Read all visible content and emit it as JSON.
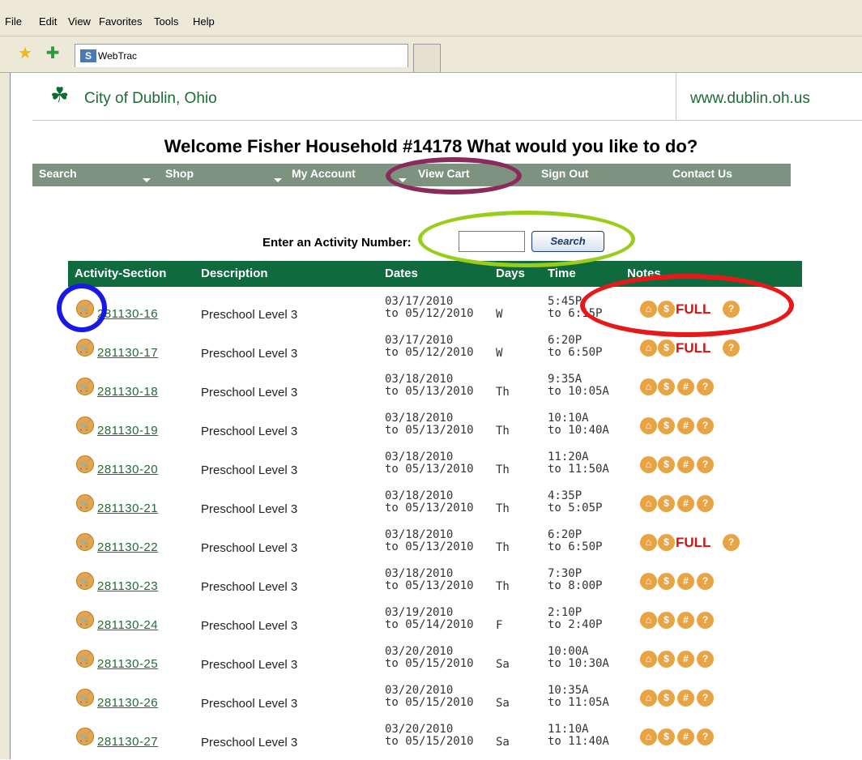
{
  "menu": [
    "File",
    "Edit",
    "View",
    "Favorites",
    "Tools",
    "Help"
  ],
  "tab": {
    "title": "WebTrac"
  },
  "site": {
    "city": "City of Dublin, Ohio",
    "url": "www.dublin.oh.us"
  },
  "welcome": "Welcome Fisher Household #14178  What would you like to do?",
  "nav": [
    "Search",
    "Shop",
    "My Account",
    "View Cart",
    "Sign Out",
    "Contact Us"
  ],
  "search": {
    "label": "Enter an Activity Number:",
    "button": "Search",
    "value": ""
  },
  "table": {
    "headers": [
      "Activity-Section",
      "Description",
      "Dates",
      "Days",
      "Time",
      "Notes"
    ],
    "rows": [
      {
        "code": "281130-16",
        "desc": "Preschool Level 3",
        "dates": "03/17/2010\nto 05/12/2010",
        "days": "W",
        "time": "5:45P\nto 6:15P",
        "full": true
      },
      {
        "code": "281130-17",
        "desc": "Preschool Level 3",
        "dates": "03/17/2010\nto 05/12/2010",
        "days": "W",
        "time": "6:20P\nto 6:50P",
        "full": true
      },
      {
        "code": "281130-18",
        "desc": "Preschool Level 3",
        "dates": "03/18/2010\nto 05/13/2010",
        "days": "Th",
        "time": "9:35A\nto 10:05A",
        "full": false
      },
      {
        "code": "281130-19",
        "desc": "Preschool Level 3",
        "dates": "03/18/2010\nto 05/13/2010",
        "days": "Th",
        "time": "10:10A\nto 10:40A",
        "full": false
      },
      {
        "code": "281130-20",
        "desc": "Preschool Level 3",
        "dates": "03/18/2010\nto 05/13/2010",
        "days": "Th",
        "time": "11:20A\nto 11:50A",
        "full": false
      },
      {
        "code": "281130-21",
        "desc": "Preschool Level 3",
        "dates": "03/18/2010\nto 05/13/2010",
        "days": "Th",
        "time": "4:35P\nto 5:05P",
        "full": false
      },
      {
        "code": "281130-22",
        "desc": "Preschool Level 3",
        "dates": "03/18/2010\nto 05/13/2010",
        "days": "Th",
        "time": "6:20P\nto 6:50P",
        "full": true
      },
      {
        "code": "281130-23",
        "desc": "Preschool Level 3",
        "dates": "03/18/2010\nto 05/13/2010",
        "days": "Th",
        "time": "7:30P\nto 8:00P",
        "full": false
      },
      {
        "code": "281130-24",
        "desc": "Preschool Level 3",
        "dates": "03/19/2010\nto 05/14/2010",
        "days": "F",
        "time": "2:10P\nto 2:40P",
        "full": false
      },
      {
        "code": "281130-25",
        "desc": "Preschool Level 3",
        "dates": "03/20/2010\nto 05/15/2010",
        "days": "Sa",
        "time": "10:00A\nto 10:30A",
        "full": false
      },
      {
        "code": "281130-26",
        "desc": "Preschool Level 3",
        "dates": "03/20/2010\nto 05/15/2010",
        "days": "Sa",
        "time": "10:35A\nto 11:05A",
        "full": false
      },
      {
        "code": "281130-27",
        "desc": "Preschool Level 3",
        "dates": "03/20/2010\nto 05/15/2010",
        "days": "Sa",
        "time": "11:10A\nto 11:40A",
        "full": false
      }
    ],
    "full_label": "FULL"
  },
  "colors": {
    "nav": "#7d9380",
    "header": "#0f6b3d",
    "link": "#1f6b35",
    "full": "#d21414",
    "icon": "#e9a441"
  }
}
